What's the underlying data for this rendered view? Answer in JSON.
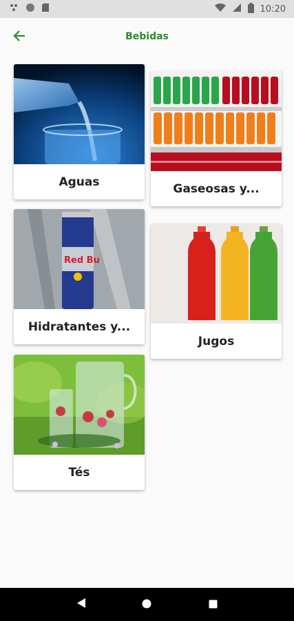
{
  "status": {
    "time": "10:20"
  },
  "header": {
    "title": "Bebidas"
  },
  "categories": [
    {
      "label": "Aguas"
    },
    {
      "label": "Gaseosas y..."
    },
    {
      "label": "Hidratantes y..."
    },
    {
      "label": "Jugos"
    },
    {
      "label": "Tés"
    }
  ],
  "colors": {
    "accent": "#2e8b2e",
    "status_bar": "#e0e0e0",
    "nav_bar": "#000000"
  }
}
